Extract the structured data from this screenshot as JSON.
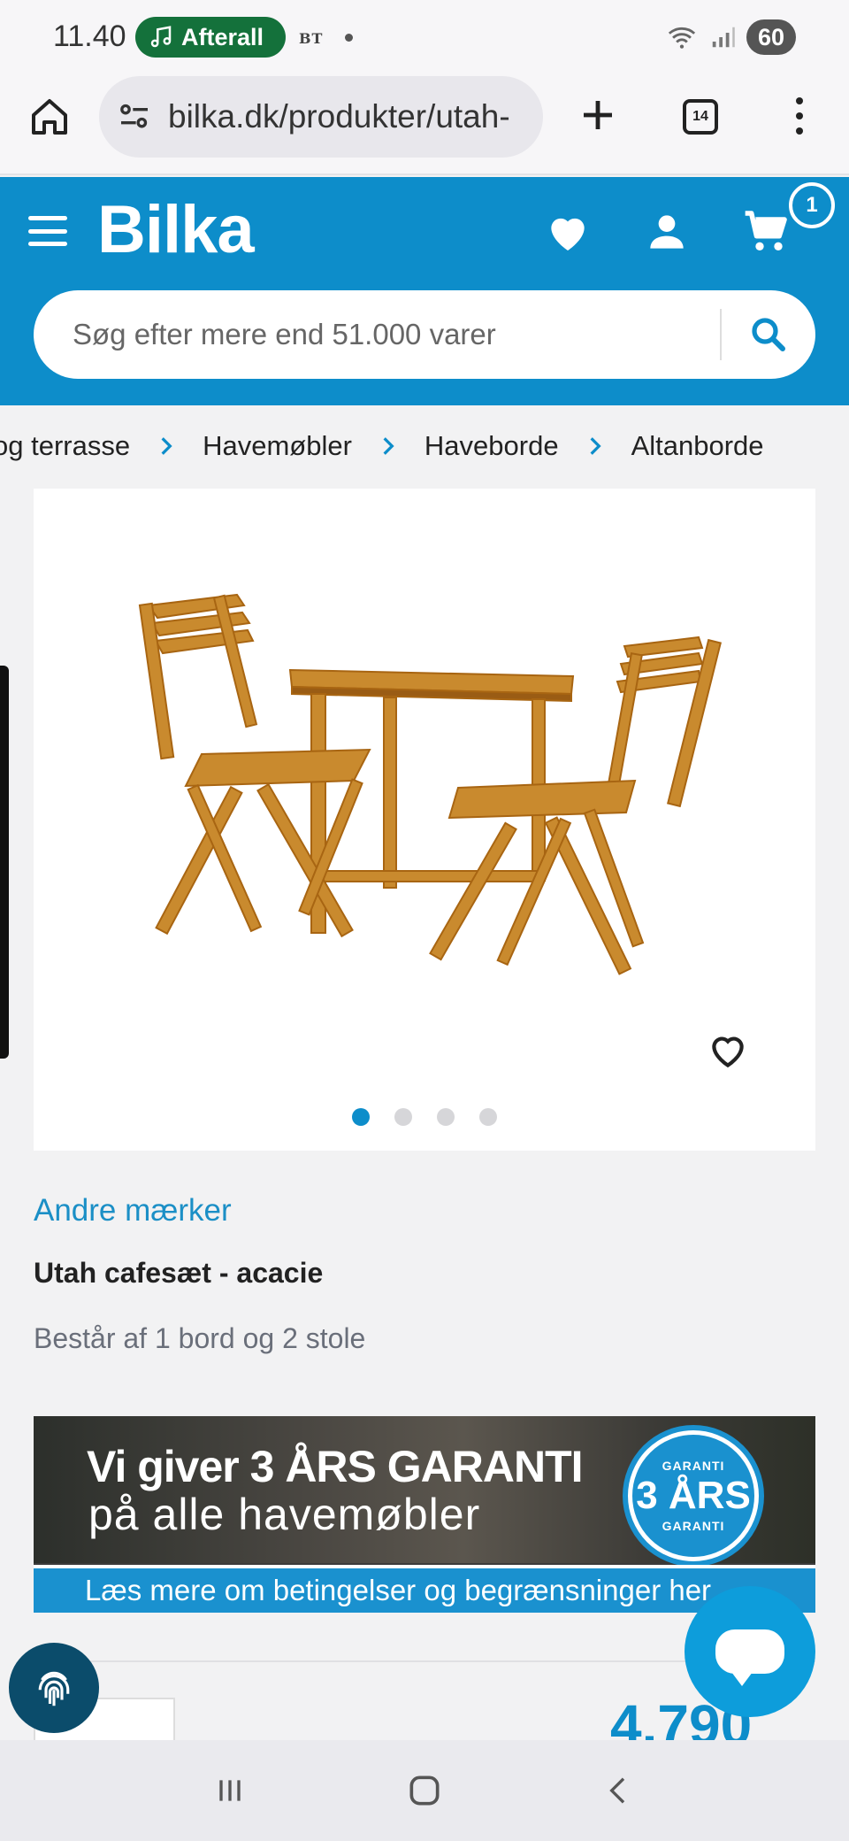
{
  "status_bar": {
    "time": "11.40",
    "media_app": "Afterall",
    "notification_tag": "BT",
    "battery": "60"
  },
  "browser": {
    "url": "bilka.dk/produkter/utah-",
    "tab_count": "14"
  },
  "header": {
    "logo": "Bilka",
    "cart_count": "1",
    "search_placeholder": "Søg efter mere end 51.000 varer"
  },
  "breadcrumb": [
    "og terrasse",
    "Havemøbler",
    "Haveborde",
    "Altanborde"
  ],
  "product": {
    "brand": "Andre mærker",
    "title": "Utah cafesæt - acacie",
    "subtitle": "Består af 1 bord og 2 stole",
    "image_count": 4,
    "active_image": 1,
    "price_partial": "4.790"
  },
  "banner": {
    "line1": "Vi giver 3 ÅRS GARANTI",
    "line2": "på alle havemøbler",
    "badge_top": "GARANTI",
    "badge_main": "3 ÅRS",
    "badge_bottom": "GARANTI",
    "strip": "Læs mere om betingelser og begrænsninger her"
  },
  "colors": {
    "brand_blue": "#0d8dca",
    "media_green": "#14713b"
  }
}
